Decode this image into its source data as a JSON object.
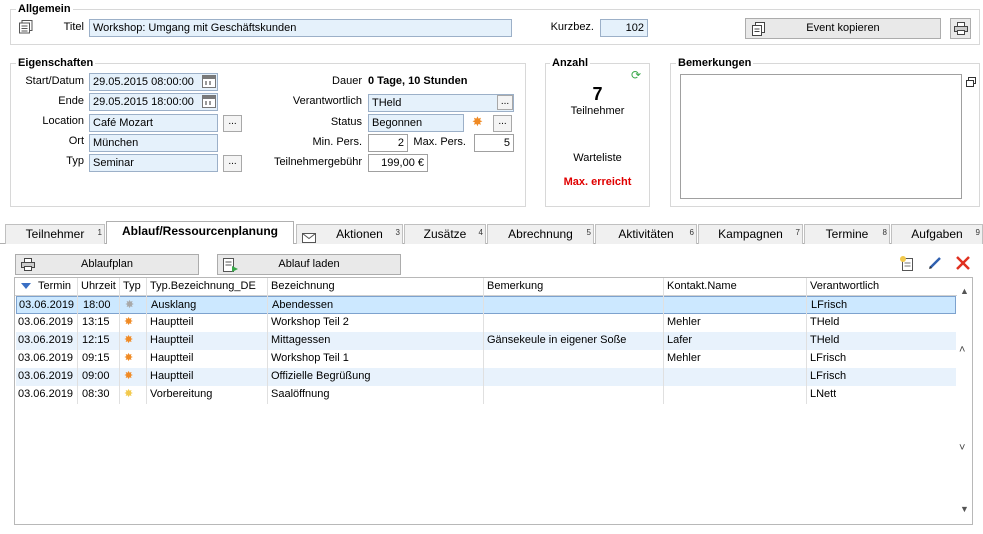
{
  "allgemein": {
    "title": "Allgemein",
    "titel_label": "Titel",
    "titel_value": "Workshop: Umgang mit Geschäftskunden",
    "kurzbez_label": "Kurzbez.",
    "kurzbez_value": "102",
    "copy_button": "Event kopieren"
  },
  "eigenschaften": {
    "title": "Eigenschaften",
    "start_label": "Start/Datum",
    "start_value": "29.05.2015 08:00:00",
    "ende_label": "Ende",
    "ende_value": "29.05.2015 18:00:00",
    "location_label": "Location",
    "location_value": "Café Mozart",
    "ort_label": "Ort",
    "ort_value": "München",
    "typ_label": "Typ",
    "typ_value": "Seminar",
    "dauer_label": "Dauer",
    "dauer_value": "0 Tage, 10 Stunden",
    "verantwortlich_label": "Verantwortlich",
    "verantwortlich_value": "THeld",
    "status_label": "Status",
    "status_value": "Begonnen",
    "min_label": "Min. Pers.",
    "min_value": "2",
    "max_label": "Max. Pers.",
    "max_value": "5",
    "gebuehr_label": "Teilnehmergebühr",
    "gebuehr_value": "199,00 €",
    "dots": "..."
  },
  "anzahl": {
    "title": "Anzahl",
    "count": "7",
    "teilnehmer": "Teilnehmer",
    "warteliste": "Warteliste",
    "max_erreicht": "Max. erreicht",
    "max_color": "#e00000"
  },
  "bemerkungen": {
    "title": "Bemerkungen"
  },
  "tabs": [
    {
      "label": "Teilnehmer",
      "num": "1"
    },
    {
      "label": "Ablauf/Ressourcenplanung",
      "num": ""
    },
    {
      "label": "Aktionen",
      "num": "3"
    },
    {
      "label": "Zusätze",
      "num": "4"
    },
    {
      "label": "Abrechnung",
      "num": "5"
    },
    {
      "label": "Aktivitäten",
      "num": "6"
    },
    {
      "label": "Kampagnen",
      "num": "7"
    },
    {
      "label": "Termine",
      "num": "8"
    },
    {
      "label": "Aufgaben",
      "num": "9"
    }
  ],
  "toolbar": {
    "ablaufplan": "Ablaufplan",
    "ablauf_laden": "Ablauf laden"
  },
  "grid": {
    "columns": [
      "Termin",
      "Uhrzeit",
      "Typ",
      "Typ.Bezeichnung_DE",
      "Bezeichnung",
      "Bemerkung",
      "Kontakt.Name",
      "Verantwortlich"
    ],
    "rows": [
      {
        "termin": "03.06.2019",
        "uhrzeit": "18:00",
        "typ_icon": "sun-grey-icon",
        "typ_bez": "Ausklang",
        "bez": "Abendessen",
        "bem": "",
        "kontakt": "",
        "verantw": "LFrisch"
      },
      {
        "termin": "03.06.2019",
        "uhrzeit": "13:15",
        "typ_icon": "sun-orange-icon",
        "typ_bez": "Hauptteil",
        "bez": "Workshop Teil 2",
        "bem": "",
        "kontakt": "Mehler",
        "verantw": "THeld"
      },
      {
        "termin": "03.06.2019",
        "uhrzeit": "12:15",
        "typ_icon": "sun-orange-icon",
        "typ_bez": "Hauptteil",
        "bez": "Mittagessen",
        "bem": "Gänsekeule in eigener Soße",
        "kontakt": "Lafer",
        "verantw": "THeld"
      },
      {
        "termin": "03.06.2019",
        "uhrzeit": "09:15",
        "typ_icon": "sun-orange-icon",
        "typ_bez": "Hauptteil",
        "bez": "Workshop Teil 1",
        "bem": "",
        "kontakt": "Mehler",
        "verantw": "LFrisch"
      },
      {
        "termin": "03.06.2019",
        "uhrzeit": "09:00",
        "typ_icon": "sun-orange-icon",
        "typ_bez": "Hauptteil",
        "bez": "Offizielle Begrüßung",
        "bem": "",
        "kontakt": "",
        "verantw": "LFrisch"
      },
      {
        "termin": "03.06.2019",
        "uhrzeit": "08:30",
        "typ_icon": "sun-yellow-icon",
        "typ_bez": "Vorbereitung",
        "bez": "Saalöffnung",
        "bem": "",
        "kontakt": "",
        "verantw": "LNett"
      }
    ]
  },
  "colors": {
    "field_bg": "#e5f1fb",
    "selected_row": "#cce8ff",
    "alt_row": "#e8f2fc",
    "sun_orange": "#f08a24",
    "sun_grey": "#a8a8a8",
    "sun_yellow": "#f2c94c",
    "delete_red": "#e03020",
    "refresh_green": "#3aa84a"
  }
}
